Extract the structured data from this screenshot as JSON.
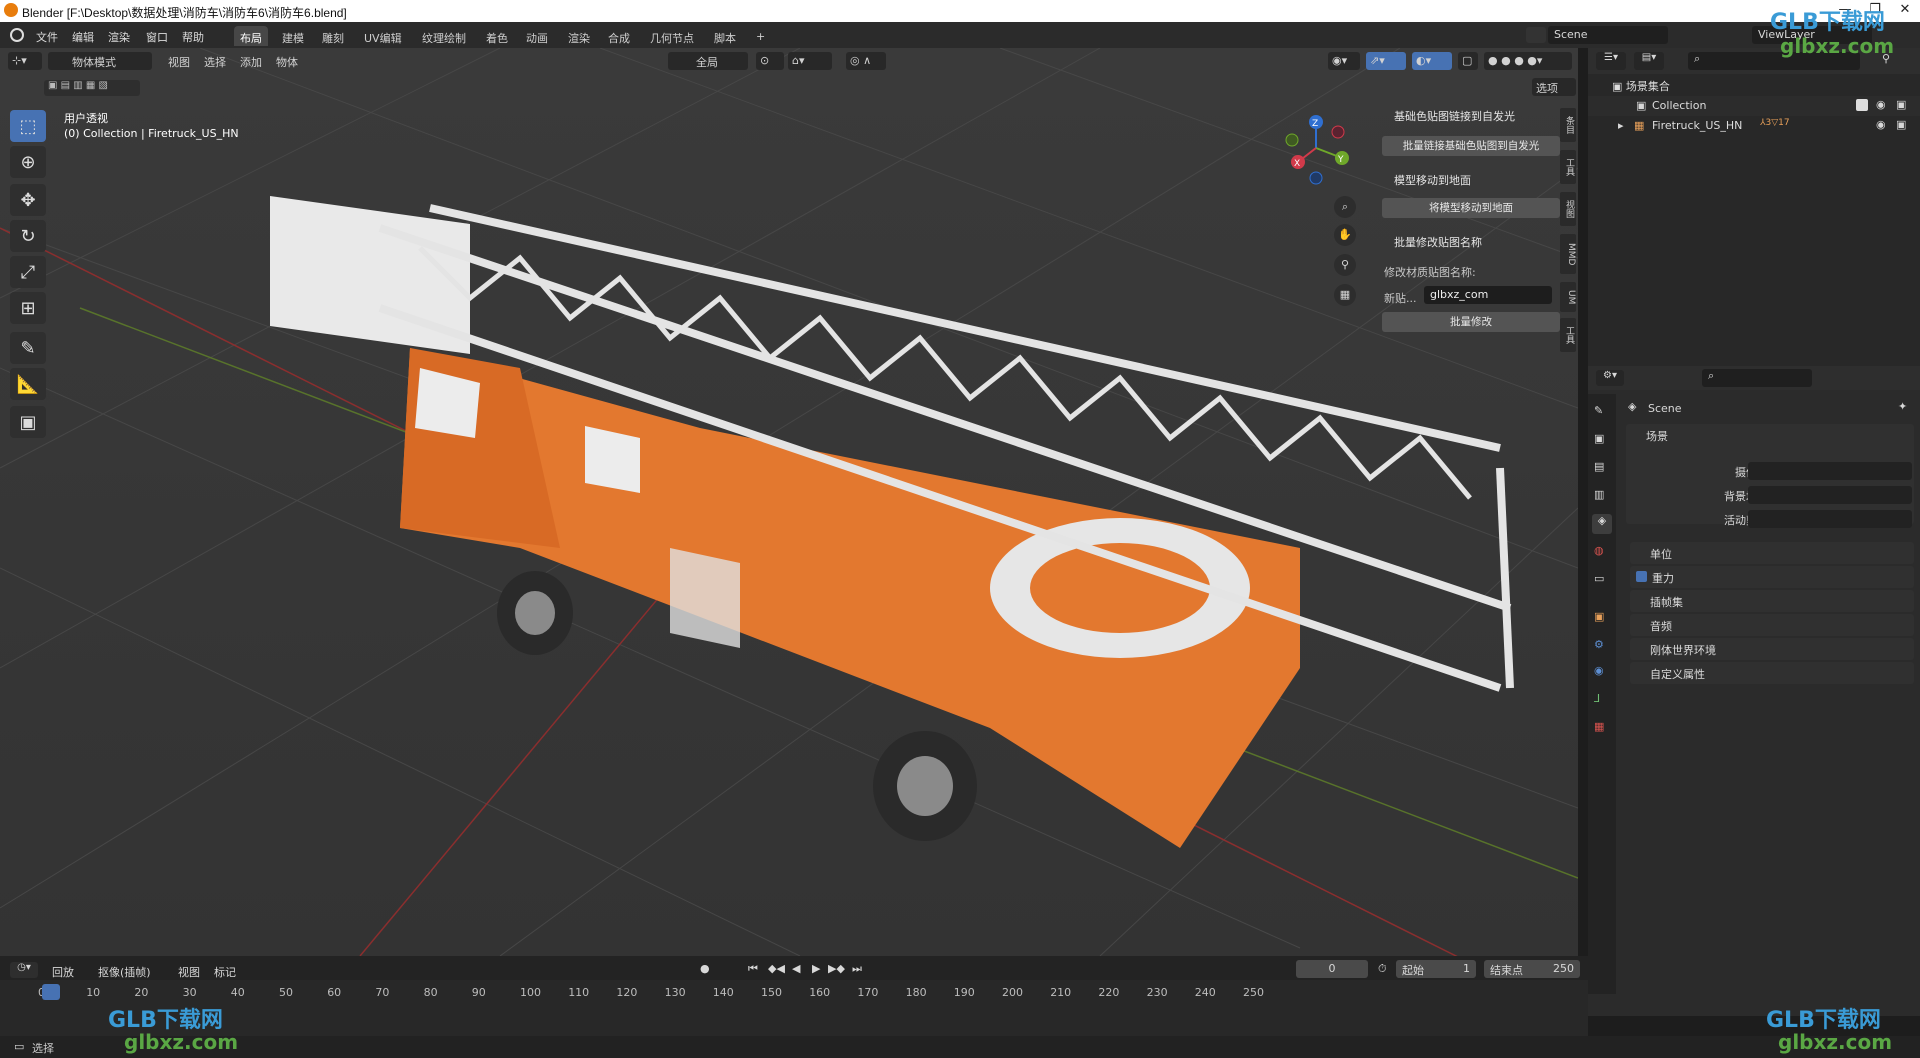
{
  "titlebar": {
    "title": "Blender [F:\\Desktop\\数据处理\\消防车\\消防车6\\消防车6.blend]"
  },
  "menu": [
    "文件",
    "编辑",
    "渲染",
    "窗口",
    "帮助"
  ],
  "workspaces": [
    "布局",
    "建模",
    "雕刻",
    "UV编辑",
    "纹理绘制",
    "着色",
    "动画",
    "渲染",
    "合成",
    "几何节点",
    "脚本"
  ],
  "workspace_add": "+",
  "scene_name": "Scene",
  "viewlayer_name": "ViewLayer",
  "viewport": {
    "mode": "物体模式",
    "menus": [
      "视图",
      "选择",
      "添加",
      "物体"
    ],
    "transform_orientation": "全局",
    "options": "选项",
    "view_name": "用户透视",
    "collection_info": "(0) Collection | Firetruck_US_HN",
    "gizmo": {
      "x": "X",
      "y": "Y",
      "z": "Z"
    }
  },
  "npanel": {
    "sections": [
      {
        "title": "基础色贴图链接到自发光",
        "button": "批量链接基础色贴图到自发光"
      },
      {
        "title": "模型移动到地面",
        "button": "将模型移动到地面"
      },
      {
        "title": "批量修改贴图名称",
        "label": "修改材质贴图名称:",
        "field_label": "新贴...",
        "field_value": "glbxz_com",
        "button": "批量修改"
      }
    ],
    "vertical_tabs": [
      "条目",
      "工具",
      "视图",
      "MMD",
      "UM",
      "工具"
    ]
  },
  "outliner": {
    "root": "场景集合",
    "items": [
      {
        "label": "Collection"
      },
      {
        "label": "Firetruck_US_HN",
        "badge1": "3",
        "badge2": "17"
      }
    ]
  },
  "properties": {
    "context": "Scene",
    "section_scene": "场景",
    "fields": [
      {
        "label": "摄像机",
        "value": ""
      },
      {
        "label": "背景场景",
        "value": ""
      },
      {
        "label": "活动剪辑",
        "value": ""
      }
    ],
    "collapsed": [
      "单位",
      "重力",
      "插帧集",
      "音频",
      "刚体世界环境",
      "自定义属性"
    ]
  },
  "timeline": {
    "menus": [
      "回放",
      "抠像(插帧)",
      "视图",
      "标记"
    ],
    "current_frame": "0",
    "start_label": "起始",
    "start": "1",
    "end_label": "结束点",
    "end": "250",
    "ticks": [
      "0",
      "10",
      "20",
      "30",
      "40",
      "50",
      "60",
      "70",
      "80",
      "90",
      "100",
      "110",
      "120",
      "130",
      "140",
      "150",
      "160",
      "170",
      "180",
      "190",
      "200",
      "210",
      "220",
      "230",
      "240",
      "250"
    ]
  },
  "statusbar": {
    "left": "选择"
  },
  "watermark": {
    "brand": "GLB下载网",
    "site": "glbxz.com"
  },
  "colors": {
    "accent": "#4772b3",
    "truck": "#e3782f",
    "ladder": "#e4e4e4",
    "grid_x": "#8a2e2e",
    "grid_y": "#5c7a2a"
  }
}
